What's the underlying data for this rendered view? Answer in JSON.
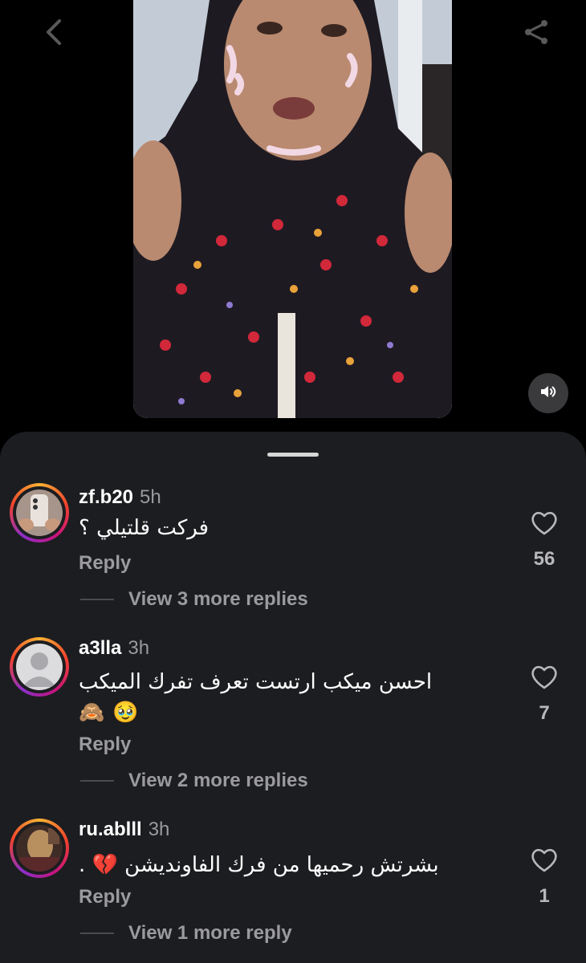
{
  "video": {
    "back_icon": "chevron-left-icon",
    "share_icon": "share-icon",
    "volume_icon": "volume-icon"
  },
  "colors": {
    "sheet_bg": "#1c1d20",
    "secondary_text": "#9a9a9f",
    "story_ring": [
      "#f9b233",
      "#f2432c",
      "#c7137c",
      "#8b2fc9"
    ]
  },
  "comments": [
    {
      "username": "zf.b20",
      "time": "5h",
      "text_lines": [
        "فركت قلتيلي ؟"
      ],
      "emoji": [],
      "reply_label": "Reply",
      "view_more": "View 3 more replies",
      "likes": "56"
    },
    {
      "username": "a3lla",
      "time": "3h",
      "text_lines": [
        "احسن ميكب ارتست تعرف تفرك الميكب"
      ],
      "emoji": [
        "🥹",
        "🙈"
      ],
      "reply_label": "Reply",
      "view_more": "View 2 more replies",
      "likes": "7"
    },
    {
      "username": "ru.ablll",
      "time": "3h",
      "text_lines": [
        "بشرتش رحميها من فرك الفاونديشن 💔 ."
      ],
      "emoji": [],
      "reply_label": "Reply",
      "view_more": "View 1 more reply",
      "likes": "1"
    }
  ]
}
